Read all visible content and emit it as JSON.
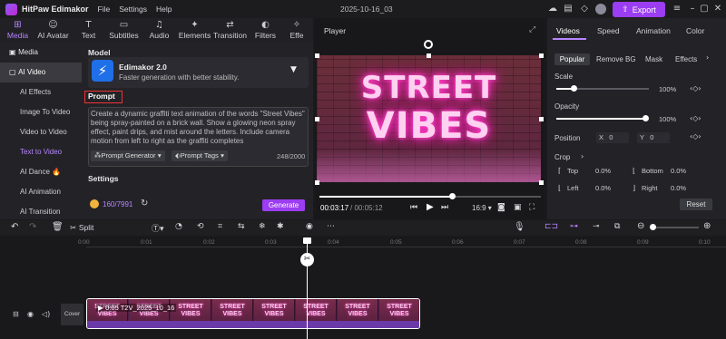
{
  "titlebar": {
    "app_title": "HitPaw Edimakor",
    "menus": [
      "File",
      "Settings",
      "Help"
    ],
    "project_name": "2025-10-16_03",
    "export_label": "Export"
  },
  "toolbar": {
    "tabs": [
      {
        "label": "Media",
        "icon": "⊞"
      },
      {
        "label": "AI Avatar",
        "icon": "☺"
      },
      {
        "label": "Text",
        "icon": "T"
      },
      {
        "label": "Subtitles",
        "icon": "▭"
      },
      {
        "label": "Audio",
        "icon": "♫"
      },
      {
        "label": "Elements",
        "icon": "✦"
      },
      {
        "label": "Transition",
        "icon": "⇄"
      },
      {
        "label": "Filters",
        "icon": "◐"
      },
      {
        "label": "Effe",
        "icon": "✧"
      }
    ]
  },
  "sidebar": {
    "items": [
      {
        "label": "Media"
      },
      {
        "label": "AI Video"
      },
      {
        "label": "AI Effects"
      },
      {
        "label": "Image To Video"
      },
      {
        "label": "Video to Video"
      },
      {
        "label": "Text to Video"
      },
      {
        "label": "AI Dance 🔥"
      },
      {
        "label": "AI Animation"
      },
      {
        "label": "AI Transition"
      }
    ]
  },
  "model_panel": {
    "section_label": "Model",
    "model_name": "Edimakor 2.0",
    "model_desc": "Faster generation with better stability.",
    "prompt_label": "Prompt",
    "prompt_text": "Create a dynamic graffiti text animation of the words \"Street Vibes\" being spray-painted on a brick wall. Show a glowing neon spray effect, paint drips, and mist around the letters. Include camera motion from left to right as the graffiti completes",
    "prompt_generator": "Prompt Generator",
    "prompt_tags": "Prompt Tags",
    "char_count": "248/2000",
    "settings_label": "Settings",
    "credits": "160/7991",
    "generate_label": "Generate"
  },
  "player": {
    "title": "Player",
    "canvas_line1": "STREET",
    "canvas_line2": "VIBES",
    "time_current": "00:03:17",
    "time_total": "/ 00:05:12",
    "aspect": "16:9",
    "progress": 0.6
  },
  "right_panel": {
    "tabs": [
      "Videos",
      "Speed",
      "Animation",
      "Color"
    ],
    "subtabs": [
      "Popular",
      "Remove BG",
      "Mask",
      "Effects"
    ],
    "scale_label": "Scale",
    "scale_value": "100%",
    "opacity_label": "Opacity",
    "opacity_value": "100%",
    "position_label": "Position",
    "pos_x_label": "X",
    "pos_x": "0",
    "pos_y_label": "Y",
    "pos_y": "0",
    "crop_label": "Crop",
    "crop_top_label": "Top",
    "crop_top": "0.0%",
    "crop_bottom_label": "Bottom",
    "crop_bottom": "0.0%",
    "crop_left_label": "Left",
    "crop_left": "0.0%",
    "crop_right_label": "Right",
    "crop_right": "0.0%",
    "reset_label": "Reset"
  },
  "timeline": {
    "split_label": "Split",
    "ticks": [
      "0:00",
      "0:01",
      "0:02",
      "0:03",
      "0:04",
      "0:05",
      "0:06",
      "0:07",
      "0:08",
      "0:09",
      "0:10"
    ],
    "clip_label": "0:05  T2V_2025_10_16",
    "cover_label": "Cover",
    "thumb_text": "STREET VIBES"
  },
  "colors": {
    "accent": "#9b3df2",
    "active_tab": "#b784ff",
    "prompt_highlight": "#e33333"
  }
}
